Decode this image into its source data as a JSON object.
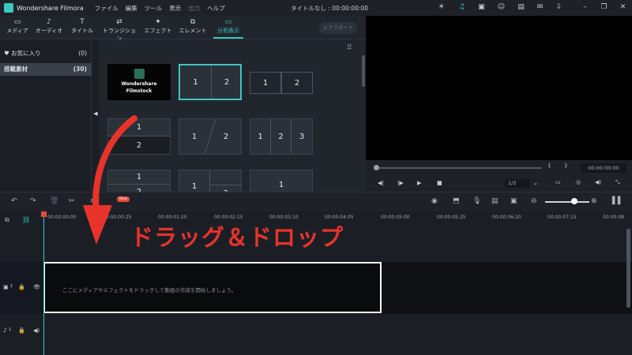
{
  "app": {
    "name": "Wondershare Filmora",
    "menu": [
      "ファイル",
      "編集",
      "ツール",
      "表示",
      "出力",
      "ヘルプ"
    ],
    "doc_title": "タイトルなし : 00:00:00:00"
  },
  "toolbar": {
    "tabs": [
      "メディア",
      "オーディオ",
      "タイトル",
      "トランジション",
      "エフェクト",
      "エレメント",
      "分割表示"
    ],
    "active_tab": "分割表示",
    "export_label": "エクスポート"
  },
  "sidebar": {
    "items": [
      {
        "label": "お気に入り",
        "count": "(0)"
      },
      {
        "label": "搭載素材",
        "count": "(30)"
      }
    ]
  },
  "grid": {
    "filmstock_line1": "Wondershare",
    "filmstock_line2": "Filmstock",
    "n1": "1",
    "n2": "2",
    "n3": "3"
  },
  "preview": {
    "timecode": "00:00:00:00",
    "ratio": "1/2",
    "brace_open": "{",
    "brace_close": "}"
  },
  "timeline": {
    "new_badge": "New",
    "ruler": [
      "00:00:00:00",
      "00:00:00:25",
      "00:00:01:20",
      "00:00:02:15",
      "00:00:03:10",
      "00:00:04:05",
      "00:00:05:00",
      "00:00:05:25",
      "00:00:06:20",
      "00:00:07:15",
      "00:00:08"
    ],
    "drop_hint": "ここにメディアやエフェクトをドラッグして動画の作成を開始しましょう。",
    "track_video_label": "1",
    "track_audio_label": "1"
  },
  "overlay": {
    "text": "ドラッグ＆ドロップ",
    "color": "#e8332b"
  },
  "colors": {
    "accent": "#3ec6c0",
    "bg": "#1b1f25"
  }
}
